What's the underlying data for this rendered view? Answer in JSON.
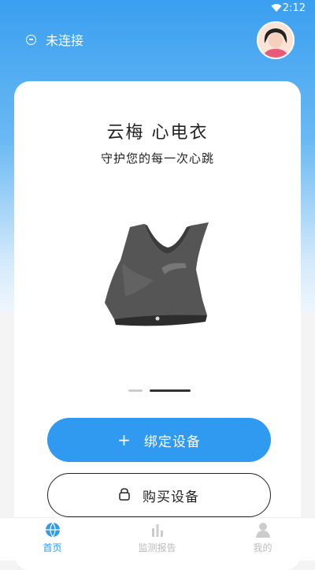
{
  "status": {
    "time": "2:12"
  },
  "header": {
    "connection_status": "未连接"
  },
  "brand": {
    "title": "云梅 心电衣",
    "slogan": "守护您的每一次心跳"
  },
  "actions": {
    "bind_label": "绑定设备",
    "buy_label": "购买设备"
  },
  "tabs": [
    {
      "label": "首页",
      "active": true
    },
    {
      "label": "监测报告",
      "active": false
    },
    {
      "label": "我的",
      "active": false
    }
  ],
  "colors": {
    "primary": "#2f9af0",
    "header_gradient_top": "#3a9ff0"
  },
  "carousel": {
    "slides": 2,
    "active": 2
  }
}
